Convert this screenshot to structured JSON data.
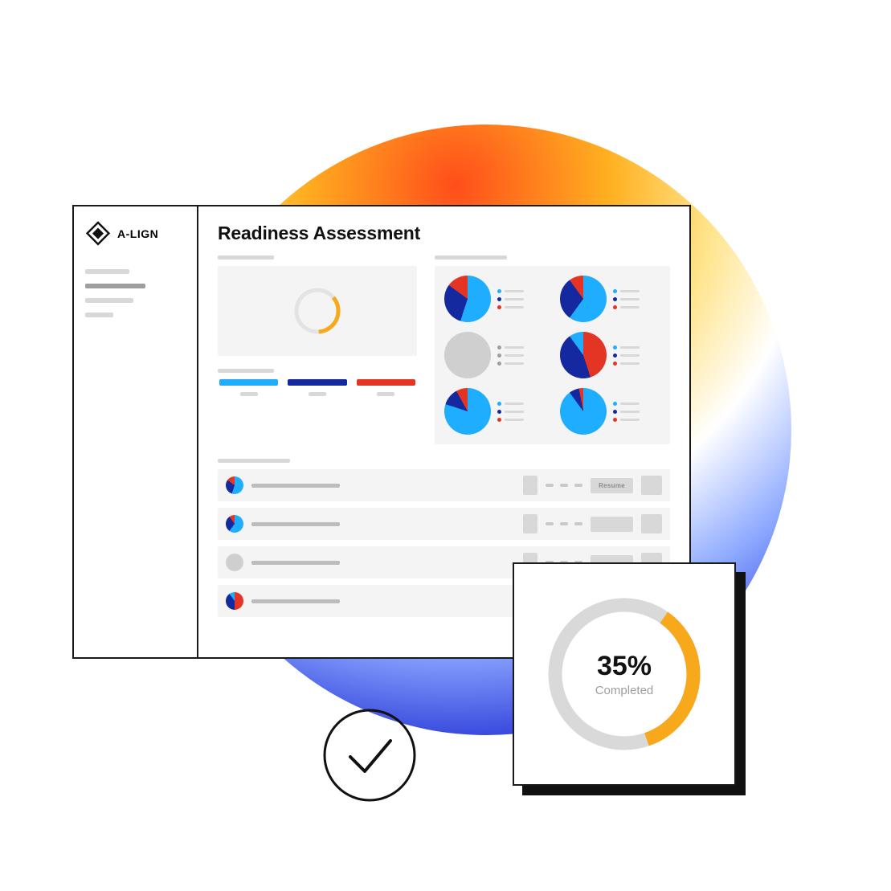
{
  "brand": {
    "name": "A-LIGN"
  },
  "page": {
    "title": "Readiness Assessment"
  },
  "colors": {
    "blue_light": "#1faeff",
    "blue_dark": "#1428a0",
    "red": "#e43524",
    "orange": "#f7a81b",
    "grey": "#cfcfcf",
    "grey_dark": "#9e9e9e"
  },
  "chart_data": {
    "overall_progress_ring": {
      "type": "pie",
      "title": "",
      "values": [
        35,
        65
      ],
      "colors": [
        "#f7a81b",
        "#e3e3e3"
      ]
    },
    "category_legend": [
      {
        "color": "#1faeff"
      },
      {
        "color": "#1428a0"
      },
      {
        "color": "#e43524"
      }
    ],
    "mini_pies": [
      {
        "type": "pie",
        "values": [
          55,
          30,
          15
        ],
        "colors": [
          "#1faeff",
          "#1428a0",
          "#e43524"
        ]
      },
      {
        "type": "pie",
        "values": [
          60,
          30,
          10
        ],
        "colors": [
          "#1faeff",
          "#1428a0",
          "#e43524"
        ]
      },
      {
        "type": "pie",
        "values": [
          100
        ],
        "colors": [
          "#cfcfcf"
        ]
      },
      {
        "type": "pie",
        "values": [
          45,
          45,
          10
        ],
        "colors": [
          "#e43524",
          "#1428a0",
          "#1faeff"
        ]
      },
      {
        "type": "pie",
        "values": [
          80,
          12,
          8
        ],
        "colors": [
          "#1faeff",
          "#1428a0",
          "#e43524"
        ]
      },
      {
        "type": "pie",
        "values": [
          90,
          7,
          3
        ],
        "colors": [
          "#1faeff",
          "#1428a0",
          "#e43524"
        ]
      }
    ]
  },
  "list": {
    "resume_label": "Resume",
    "rows": [
      {
        "pie": {
          "type": "pie",
          "values": [
            55,
            30,
            15
          ],
          "colors": [
            "#1faeff",
            "#1428a0",
            "#e43524"
          ]
        },
        "action": "Resume"
      },
      {
        "pie": {
          "type": "pie",
          "values": [
            60,
            30,
            10
          ],
          "colors": [
            "#1faeff",
            "#1428a0",
            "#e43524"
          ]
        },
        "action": ""
      },
      {
        "pie": {
          "type": "pie",
          "values": [
            100
          ],
          "colors": [
            "#cfcfcf"
          ]
        },
        "action": ""
      },
      {
        "pie": {
          "type": "pie",
          "values": [
            50,
            40,
            10
          ],
          "colors": [
            "#e43524",
            "#1428a0",
            "#1faeff"
          ]
        },
        "action": ""
      }
    ]
  },
  "progress_card": {
    "chart": {
      "type": "pie",
      "values": [
        35,
        65
      ],
      "colors": [
        "#f7a81b",
        "#d9d9d9"
      ]
    },
    "value": "35%",
    "label": "Completed"
  }
}
